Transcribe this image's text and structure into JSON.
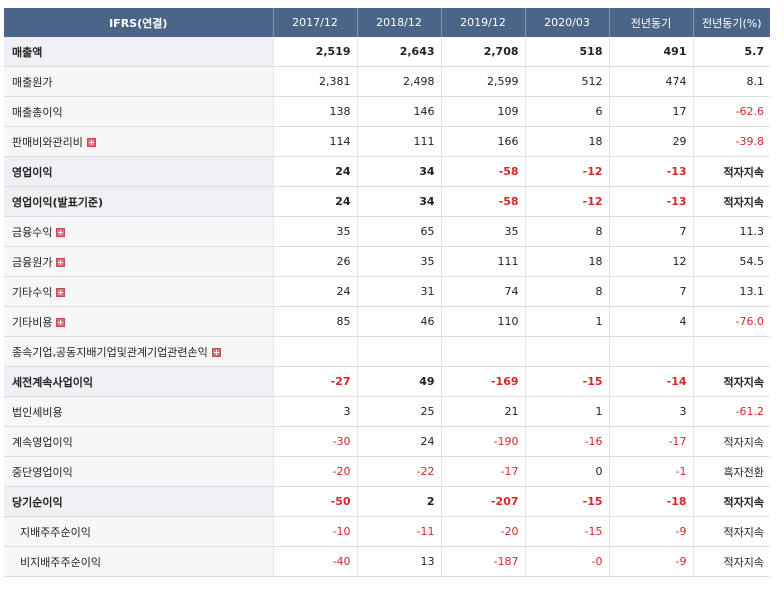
{
  "header": {
    "label": "IFRS(연결)",
    "columns": [
      "2017/12",
      "2018/12",
      "2019/12",
      "2020/03",
      "전년동기",
      "전년동기(%)"
    ]
  },
  "rows": [
    {
      "label": "매출액",
      "bold": true,
      "expand": false,
      "values": [
        "2,519",
        "2,643",
        "2,708",
        "518",
        "491",
        "5.7"
      ]
    },
    {
      "label": "매출원가",
      "bold": false,
      "expand": false,
      "values": [
        "2,381",
        "2,498",
        "2,599",
        "512",
        "474",
        "8.1"
      ]
    },
    {
      "label": "매출총이익",
      "bold": false,
      "expand": false,
      "values": [
        "138",
        "146",
        "109",
        "6",
        "17",
        "-62.6"
      ]
    },
    {
      "label": "판매비와관리비",
      "bold": false,
      "expand": true,
      "values": [
        "114",
        "111",
        "166",
        "18",
        "29",
        "-39.8"
      ]
    },
    {
      "label": "영업이익",
      "bold": true,
      "expand": false,
      "values": [
        "24",
        "34",
        "-58",
        "-12",
        "-13",
        "적자지속"
      ]
    },
    {
      "label": "영업이익(발표기준)",
      "bold": true,
      "expand": false,
      "values": [
        "24",
        "34",
        "-58",
        "-12",
        "-13",
        "적자지속"
      ]
    },
    {
      "label": "금융수익",
      "bold": false,
      "expand": true,
      "values": [
        "35",
        "65",
        "35",
        "8",
        "7",
        "11.3"
      ]
    },
    {
      "label": "금융원가",
      "bold": false,
      "expand": true,
      "values": [
        "26",
        "35",
        "111",
        "18",
        "12",
        "54.5"
      ]
    },
    {
      "label": "기타수익",
      "bold": false,
      "expand": true,
      "values": [
        "24",
        "31",
        "74",
        "8",
        "7",
        "13.1"
      ]
    },
    {
      "label": "기타비용",
      "bold": false,
      "expand": true,
      "values": [
        "85",
        "46",
        "110",
        "1",
        "4",
        "-76.0"
      ]
    },
    {
      "label": "종속기업,공동지배기업및관계기업관련손익",
      "bold": false,
      "expand": true,
      "values": [
        "",
        "",
        "",
        "",
        "",
        ""
      ]
    },
    {
      "label": "세전계속사업이익",
      "bold": true,
      "expand": false,
      "values": [
        "-27",
        "49",
        "-169",
        "-15",
        "-14",
        "적자지속"
      ]
    },
    {
      "label": "법인세비용",
      "bold": false,
      "expand": false,
      "values": [
        "3",
        "25",
        "21",
        "1",
        "3",
        "-61.2"
      ]
    },
    {
      "label": "계속영업이익",
      "bold": false,
      "expand": false,
      "values": [
        "-30",
        "24",
        "-190",
        "-16",
        "-17",
        "적자지속"
      ]
    },
    {
      "label": "중단영업이익",
      "bold": false,
      "expand": false,
      "values": [
        "-20",
        "-22",
        "-17",
        "0",
        "-1",
        "흑자전환"
      ]
    },
    {
      "label": "당기순이익",
      "bold": true,
      "expand": false,
      "values": [
        "-50",
        "2",
        "-207",
        "-15",
        "-18",
        "적자지속"
      ]
    },
    {
      "label": "지배주주순이익",
      "bold": false,
      "sub": true,
      "expand": false,
      "values": [
        "-10",
        "-11",
        "-20",
        "-15",
        "-9",
        "적자지속"
      ]
    },
    {
      "label": "비지배주주순이익",
      "bold": false,
      "sub": true,
      "expand": false,
      "values": [
        "-40",
        "13",
        "-187",
        "-0",
        "-9",
        "적자지속"
      ]
    }
  ],
  "colors": {
    "header_bg": "#4a6587",
    "negative": "#d8272b"
  },
  "icons": {
    "expand": "plus-square-icon"
  }
}
